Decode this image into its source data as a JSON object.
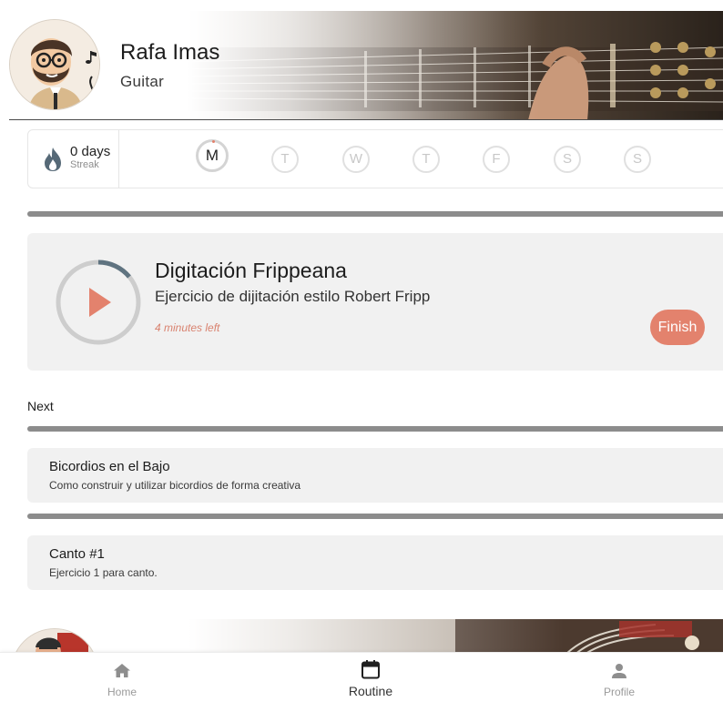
{
  "profile": {
    "name": "Rafa Imas",
    "instrument": "Guitar"
  },
  "streak": {
    "days": "0 days",
    "label": "Streak"
  },
  "week": {
    "days": [
      "M",
      "T",
      "W",
      "T",
      "F",
      "S",
      "S"
    ],
    "active_index": 0
  },
  "current": {
    "title": "Digitación Frippeana",
    "description": "Ejercicio de dijitación estilo Robert Fripp",
    "time_left": "4 minutes left",
    "finish_label": "Finish",
    "timer_progress": 0.14,
    "accent": "#e3826d"
  },
  "next": {
    "label": "Next",
    "items": [
      {
        "title": "Bicordios en el Bajo",
        "description": "Como construir y utilizar bicordios de forma creativa"
      },
      {
        "title": "Canto #1",
        "description": "Ejercicio 1 para canto."
      }
    ]
  },
  "nav": {
    "items": [
      {
        "label": "Home",
        "icon": "home-icon"
      },
      {
        "label": "Routine",
        "icon": "calendar-icon"
      },
      {
        "label": "Profile",
        "icon": "person-icon"
      }
    ],
    "active_index": 1
  }
}
